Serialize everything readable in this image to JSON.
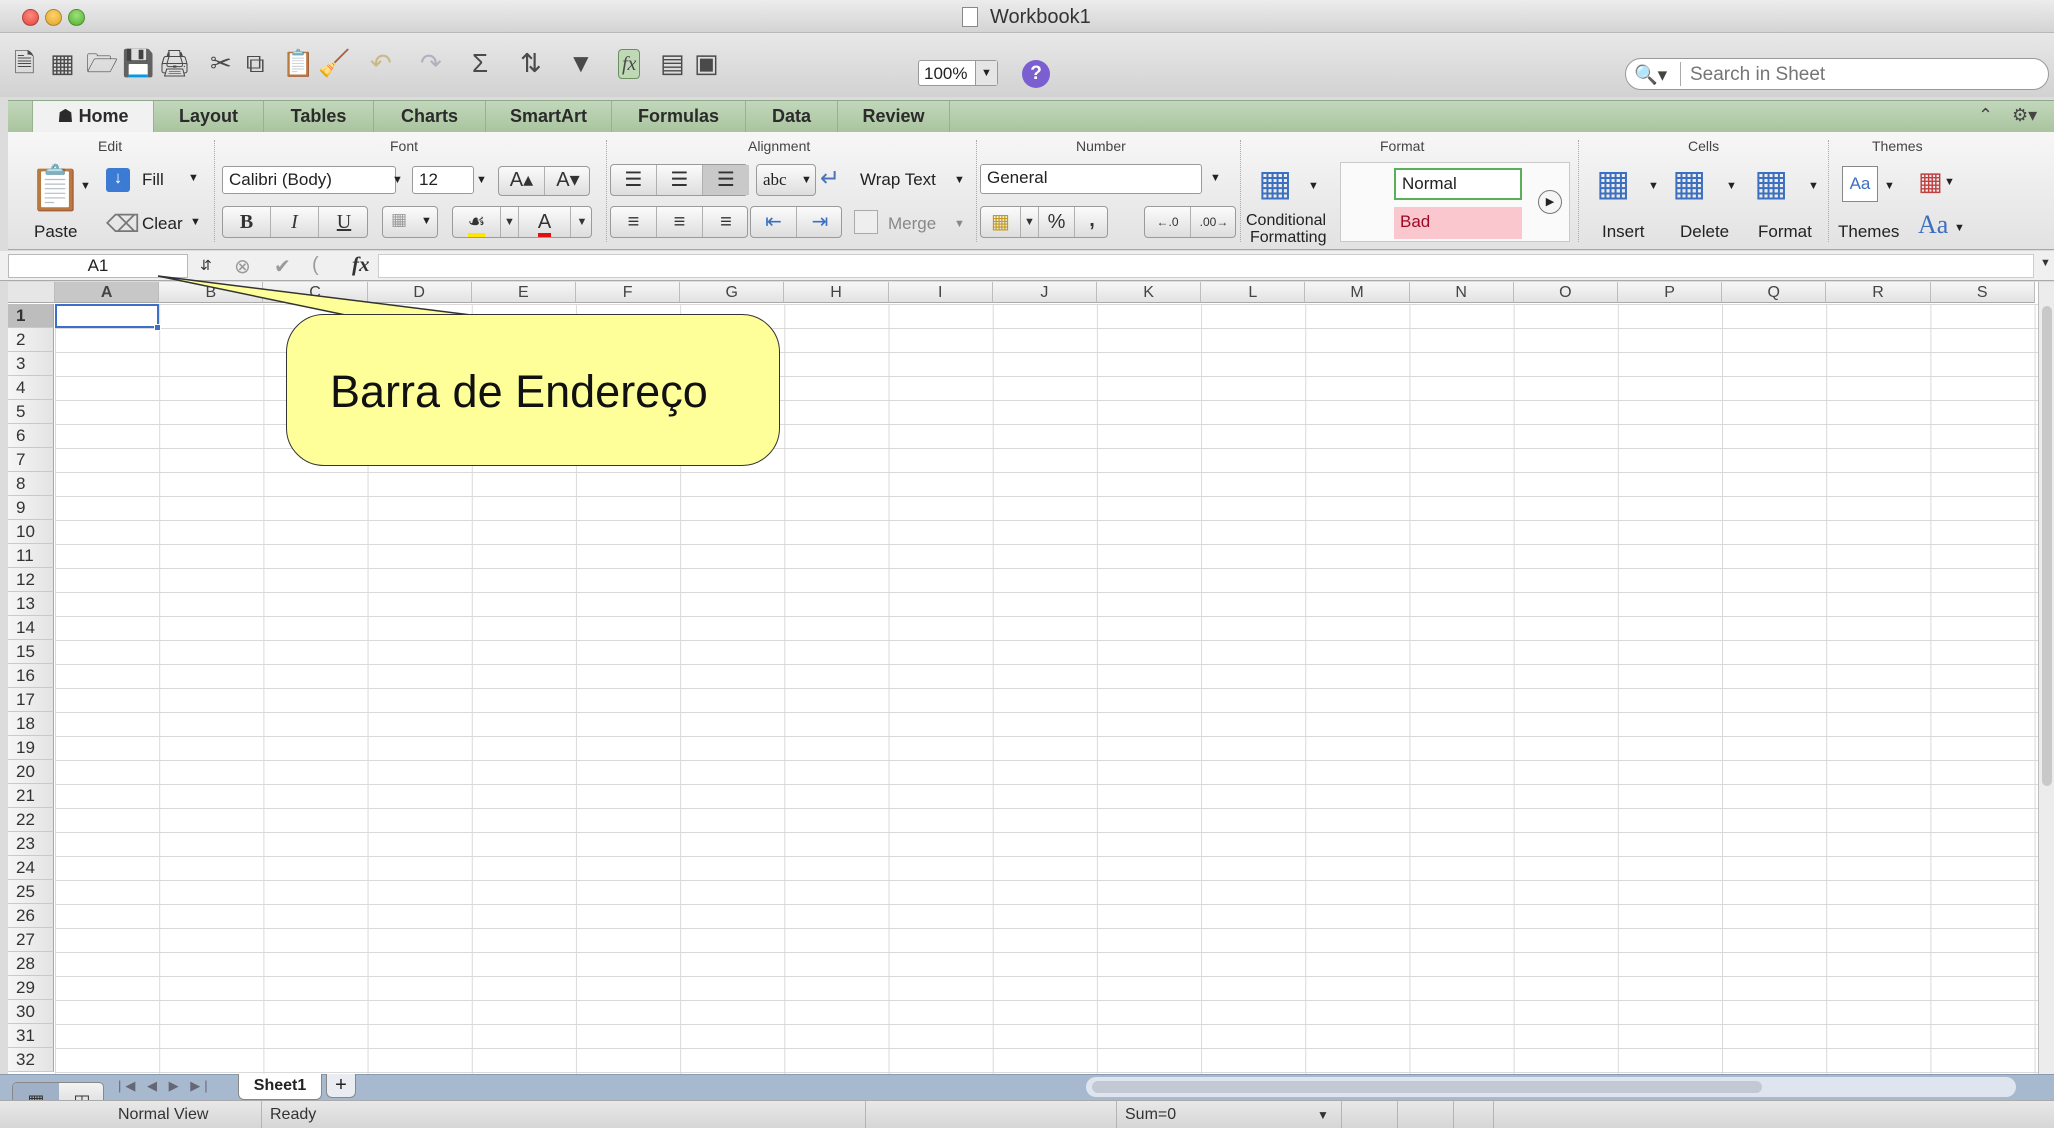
{
  "window": {
    "title": "Workbook1"
  },
  "toolbar": {
    "zoom": "100%",
    "help_label": "?",
    "search_placeholder": "Search in Sheet"
  },
  "ribbon_tabs": [
    "Home",
    "Layout",
    "Tables",
    "Charts",
    "SmartArt",
    "Formulas",
    "Data",
    "Review"
  ],
  "ribbon": {
    "groups": {
      "edit": "Edit",
      "font": "Font",
      "alignment": "Alignment",
      "number": "Number",
      "format": "Format",
      "cells": "Cells",
      "themes": "Themes"
    },
    "edit": {
      "paste": "Paste",
      "fill": "Fill",
      "clear": "Clear"
    },
    "font": {
      "family": "Calibri (Body)",
      "size": "12",
      "bold": "B",
      "italic": "I",
      "underline": "U"
    },
    "alignment": {
      "abc": "abc",
      "wrap_text": "Wrap Text",
      "merge": "Merge"
    },
    "number": {
      "format": "General",
      "percent": "%",
      "comma": ","
    },
    "format": {
      "conditional_formatting_line1": "Conditional",
      "conditional_formatting_line2": "Formatting",
      "style_normal": "Normal",
      "style_bad": "Bad"
    },
    "cells": {
      "insert": "Insert",
      "delete": "Delete",
      "format": "Format"
    },
    "themes": {
      "themes": "Themes",
      "fonts": "Aa"
    }
  },
  "formula_bar": {
    "name_box": "A1",
    "fx": "fx"
  },
  "grid": {
    "columns": [
      "A",
      "B",
      "C",
      "D",
      "E",
      "F",
      "G",
      "H",
      "I",
      "J",
      "K",
      "L",
      "M",
      "N",
      "O",
      "P",
      "Q",
      "R",
      "S"
    ],
    "rows": [
      "1",
      "2",
      "3",
      "4",
      "5",
      "6",
      "7",
      "8",
      "9",
      "10",
      "11",
      "12",
      "13",
      "14",
      "15",
      "16",
      "17",
      "18",
      "19",
      "20",
      "21",
      "22",
      "23",
      "24",
      "25",
      "26",
      "27",
      "28",
      "29",
      "30",
      "31",
      "32"
    ],
    "selected_cell": "A1"
  },
  "callout": {
    "text": "Barra de Endereço"
  },
  "sheets": {
    "tabs": [
      "Sheet1"
    ],
    "add": "+"
  },
  "statusbar": {
    "view": "Normal View",
    "state": "Ready",
    "sum": "Sum=0"
  }
}
